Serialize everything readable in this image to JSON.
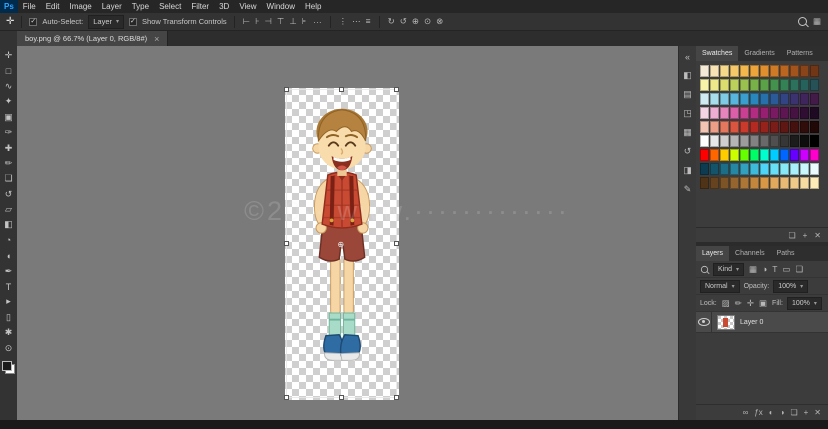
{
  "app": {
    "logo_text": "Ps"
  },
  "menubar": {
    "items": [
      "File",
      "Edit",
      "Image",
      "Layer",
      "Type",
      "Select",
      "Filter",
      "3D",
      "View",
      "Window",
      "Help"
    ]
  },
  "options_bar": {
    "tool_glyph": "✛",
    "auto_select_label": "Auto-Select:",
    "auto_select_value": "Layer",
    "dropdown_arrow": "▾",
    "show_transform_label": "Show Transform Controls",
    "align_icons": [
      "⊢",
      "⊦",
      "⊣",
      "⊤",
      "⊥",
      "⊧"
    ],
    "more_icon": "···",
    "distribute_icons": [
      "⋮",
      "⋯",
      "≡"
    ],
    "orbit_icons": [
      "↻",
      "↺",
      "⊕",
      "⊙",
      "⊗"
    ],
    "workspace_icon": "▦"
  },
  "document_tab": {
    "title": "boy.png @ 66.7% (Layer 0, RGB/8#)",
    "close_icon": "×"
  },
  "toolbar": {
    "tools": [
      {
        "name": "move-tool",
        "glyph": "✛"
      },
      {
        "name": "marquee-tool",
        "glyph": "□"
      },
      {
        "name": "lasso-tool",
        "glyph": "∿"
      },
      {
        "name": "quick-selection-tool",
        "glyph": "✦"
      },
      {
        "name": "crop-tool",
        "glyph": "▣"
      },
      {
        "name": "eyedropper-tool",
        "glyph": "✑"
      },
      {
        "name": "healing-brush-tool",
        "glyph": "✚"
      },
      {
        "name": "brush-tool",
        "glyph": "✏"
      },
      {
        "name": "clone-stamp-tool",
        "glyph": "❏"
      },
      {
        "name": "history-brush-tool",
        "glyph": "↺"
      },
      {
        "name": "eraser-tool",
        "glyph": "▱"
      },
      {
        "name": "gradient-tool",
        "glyph": "◧"
      },
      {
        "name": "blur-tool",
        "glyph": "◔"
      },
      {
        "name": "dodge-tool",
        "glyph": "◖"
      },
      {
        "name": "pen-tool",
        "glyph": "✒"
      },
      {
        "name": "type-tool",
        "glyph": "T"
      },
      {
        "name": "path-selection-tool",
        "glyph": "▸"
      },
      {
        "name": "shape-tool",
        "glyph": "▯"
      },
      {
        "name": "hand-tool",
        "glyph": "✱"
      },
      {
        "name": "zoom-tool",
        "glyph": "⊙"
      }
    ],
    "foreground_color": "#1a1a1a",
    "background_color": "#ffffff"
  },
  "canvas": {
    "watermark": "©20·· www.·············",
    "background": "#7a7a7a"
  },
  "panel_strip": {
    "icons": [
      {
        "name": "collapse-panels-icon",
        "glyph": "«"
      },
      {
        "name": "color-panel-icon",
        "glyph": "◧"
      },
      {
        "name": "properties-panel-icon",
        "glyph": "▤"
      },
      {
        "name": "adjustments-panel-icon",
        "glyph": "◳"
      },
      {
        "name": "libraries-panel-icon",
        "glyph": "▦"
      },
      {
        "name": "history-panel-icon",
        "glyph": "↺"
      },
      {
        "name": "info-panel-icon",
        "glyph": "◨"
      },
      {
        "name": "brush-settings-panel-icon",
        "glyph": "✎"
      }
    ]
  },
  "swatches_panel": {
    "tabs": [
      "Swatches",
      "Gradients",
      "Patterns"
    ],
    "rows": [
      [
        "#f5ead6",
        "#f7e3b4",
        "#f7d98c",
        "#f5c96a",
        "#f2b84e",
        "#eda43a",
        "#e08f2e",
        "#cf7a26",
        "#ba6621",
        "#a3541d",
        "#8a4419",
        "#703615"
      ],
      [
        "#f7f3a8",
        "#eee88a",
        "#dbde6f",
        "#bcd05c",
        "#9ac14f",
        "#78b148",
        "#5aa147",
        "#44914d",
        "#348156",
        "#2b715c",
        "#27615c",
        "#265156"
      ],
      [
        "#d0ecf2",
        "#a8ddec",
        "#7fcbe6",
        "#58b6dc",
        "#3a9fce",
        "#2a87bd",
        "#2670ab",
        "#2a5a98",
        "#324484",
        "#3a3370",
        "#40255c",
        "#421b48"
      ],
      [
        "#f5d4e6",
        "#eeadd2",
        "#e685bd",
        "#da5ea8",
        "#c94093",
        "#b22c82",
        "#971f72",
        "#7a1a62",
        "#5e1652",
        "#451242",
        "#300e33",
        "#1f0a24"
      ],
      [
        "#f2c4b4",
        "#ec9e86",
        "#e4785e",
        "#d9553f",
        "#c93a2c",
        "#b22a22",
        "#96221c",
        "#7a1c17",
        "#5e1713",
        "#45110e",
        "#300c0a",
        "#1f0806"
      ],
      [
        "#ffffff",
        "#e8e8e8",
        "#cfcfcf",
        "#b5b5b5",
        "#9c9c9c",
        "#828282",
        "#696969",
        "#4f4f4f",
        "#363636",
        "#1c1c1c",
        "#0d0d0d",
        "#000000"
      ],
      [
        "#ff0000",
        "#ff6600",
        "#ffcc00",
        "#ccff00",
        "#66ff00",
        "#00ff66",
        "#00ffcc",
        "#00ccff",
        "#0066ff",
        "#6600ff",
        "#cc00ff",
        "#ff00cc"
      ],
      [
        "#0d3b4f",
        "#14546b",
        "#1c6e87",
        "#2687a3",
        "#31a1bf",
        "#3ebadb",
        "#4dd4f7",
        "#66dff7",
        "#87e8f7",
        "#a8f0fa",
        "#c9f7fc",
        "#eafcfe"
      ],
      [
        "#4f3317",
        "#66431f",
        "#7d5426",
        "#94652e",
        "#ab7636",
        "#c2873d",
        "#d99845",
        "#e0a95c",
        "#e8ba73",
        "#efcb8a",
        "#f7dca1",
        "#feedb8"
      ]
    ],
    "footer_icons": [
      {
        "name": "new-swatch-group-icon",
        "glyph": "❏"
      },
      {
        "name": "new-swatch-icon",
        "glyph": "+"
      },
      {
        "name": "delete-swatch-icon",
        "glyph": "✕"
      }
    ]
  },
  "layers_panel": {
    "tabs": [
      "Layers",
      "Channels",
      "Paths"
    ],
    "filter_label": "Kind",
    "filter_icons": [
      "▦",
      "◑",
      "T",
      "▭",
      "❏"
    ],
    "blend_mode": "Normal",
    "opacity_label": "Opacity:",
    "opacity_value": "100%",
    "lock_label": "Lock:",
    "lock_icons": [
      "▨",
      "✏",
      "✛",
      "▣"
    ],
    "fill_label": "Fill:",
    "fill_value": "100%",
    "layers": [
      {
        "name": "Layer 0",
        "visible": true
      }
    ],
    "footer_icons": [
      {
        "name": "link-layers-icon",
        "glyph": "∞"
      },
      {
        "name": "layer-effects-icon",
        "glyph": "ƒx"
      },
      {
        "name": "layer-mask-icon",
        "glyph": "◐"
      },
      {
        "name": "adjustment-layer-icon",
        "glyph": "◑"
      },
      {
        "name": "layer-group-icon",
        "glyph": "❏"
      },
      {
        "name": "new-layer-icon",
        "glyph": "+"
      },
      {
        "name": "delete-layer-icon",
        "glyph": "✕"
      }
    ]
  }
}
